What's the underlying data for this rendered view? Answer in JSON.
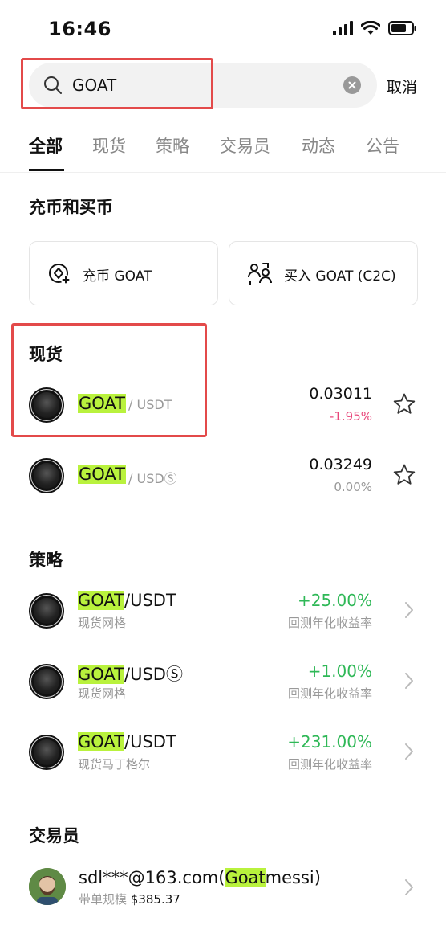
{
  "status_bar": {
    "time": "16:46"
  },
  "search": {
    "value": "GOAT",
    "cancel_label": "取消"
  },
  "tabs": [
    {
      "label": "全部",
      "active": true
    },
    {
      "label": "现货",
      "active": false
    },
    {
      "label": "策略",
      "active": false
    },
    {
      "label": "交易员",
      "active": false
    },
    {
      "label": "动态",
      "active": false
    },
    {
      "label": "公告",
      "active": false
    }
  ],
  "deposit_section": {
    "title": "充币和买币",
    "deposit_label": "充币 GOAT",
    "buy_label": "买入 GOAT (C2C)"
  },
  "spot_section": {
    "title": "现货",
    "rows": [
      {
        "base": "GOAT",
        "quote": "/ USDT",
        "price": "0.03011",
        "change": "-1.95%",
        "change_color": "#e8467a"
      },
      {
        "base": "GOAT",
        "quote": "/ USDⓈ",
        "price": "0.03249",
        "change": "0.00%",
        "change_color": "#999999"
      }
    ]
  },
  "strategy_section": {
    "title": "策略",
    "rows": [
      {
        "base": "GOAT",
        "quote": "/USDT",
        "type": "现货网格",
        "rate": "+25.00%",
        "rate_label": "回测年化收益率"
      },
      {
        "base": "GOAT",
        "quote": "/USDⓈ",
        "type": "现货网格",
        "rate": "+1.00%",
        "rate_label": "回测年化收益率"
      },
      {
        "base": "GOAT",
        "quote": "/USDT",
        "type": "现货马丁格尔",
        "rate": "+231.00%",
        "rate_label": "回测年化收益率"
      }
    ]
  },
  "trader_section": {
    "title": "交易员",
    "name_prefix": "sdl***@163.com(",
    "name_highlight": "Goat",
    "name_suffix": "messi)",
    "sub_label": "带单规模",
    "sub_value": "$385.37"
  },
  "colors": {
    "accent_highlight": "#b9f23d",
    "positive": "#2fb857",
    "negative": "#e8467a",
    "annotation_box": "#e34a4a"
  }
}
